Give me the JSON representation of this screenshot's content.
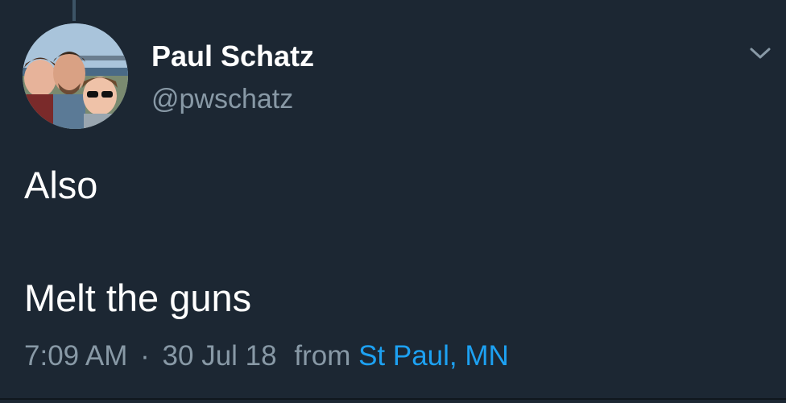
{
  "author": {
    "display_name": "Paul Schatz",
    "handle": "@pwschatz",
    "avatar_icon": "profile-photo"
  },
  "tweet": {
    "lines": [
      "Also",
      "Melt the guns"
    ]
  },
  "meta": {
    "time": "7:09 AM",
    "separator": "·",
    "date": "30 Jul 18",
    "from_label": "from",
    "location": "St Paul, MN"
  },
  "colors": {
    "background": "#1c2733",
    "secondary_text": "#8899a6",
    "link": "#1da1f2"
  }
}
